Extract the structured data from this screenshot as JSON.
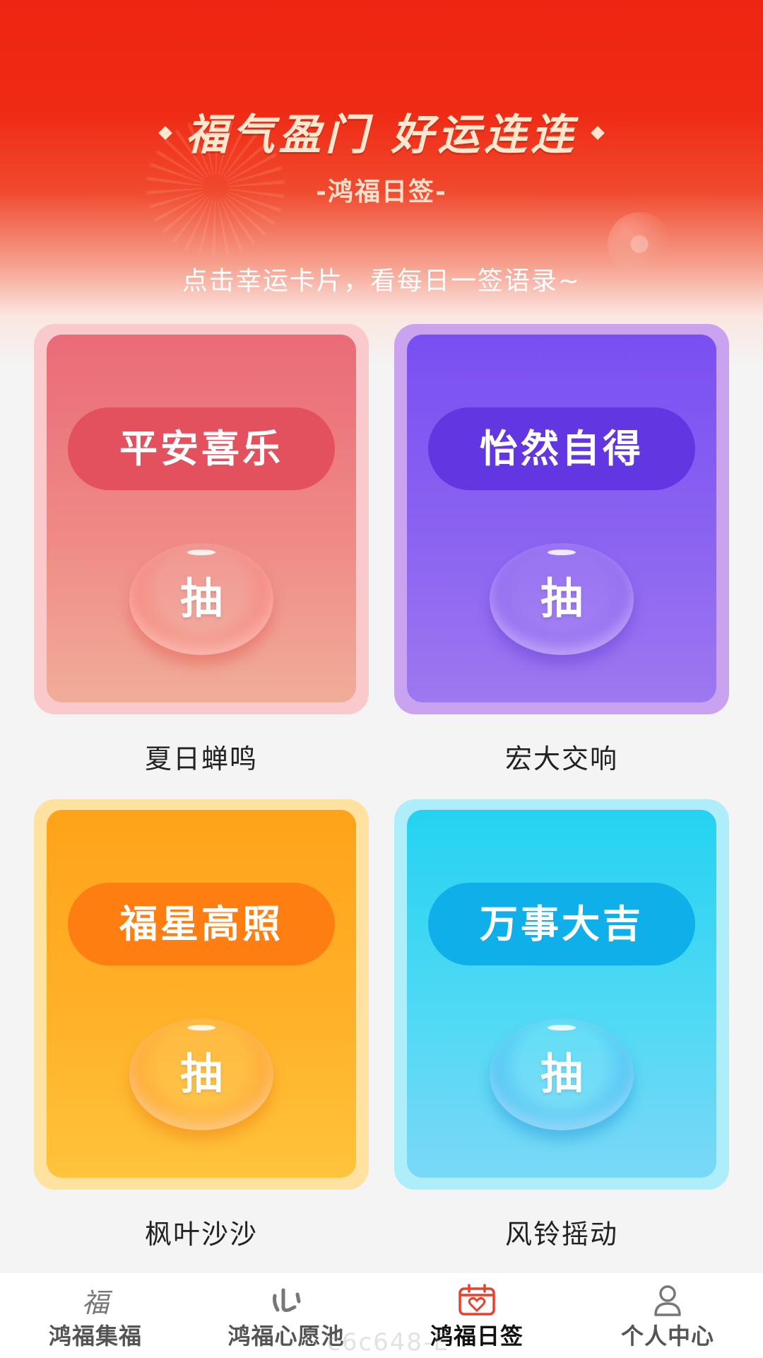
{
  "header": {
    "title": "福气盈门 好运连连",
    "subtitle": "-鸿福日签-",
    "tip": "点击幸运卡片，看每日一签语录~"
  },
  "cards": [
    {
      "pill": "平安喜乐",
      "button": "抽",
      "name": "夏日蝉鸣",
      "theme": "pink",
      "accent": "#e3505e"
    },
    {
      "pill": "怡然自得",
      "button": "抽",
      "name": "宏大交响",
      "theme": "purple",
      "accent": "#6236e0"
    },
    {
      "pill": "福星高照",
      "button": "抽",
      "name": "枫叶沙沙",
      "theme": "orange",
      "accent": "#ff7e11"
    },
    {
      "pill": "万事大吉",
      "button": "抽",
      "name": "风铃摇动",
      "theme": "cyan",
      "accent": "#0fb0ea"
    }
  ],
  "nav": {
    "items": [
      {
        "label": "鸿福集福",
        "icon": "fu-character-icon",
        "icon_text": "福",
        "active": false
      },
      {
        "label": "鸿福心愿池",
        "icon": "heart-wish-icon",
        "active": false
      },
      {
        "label": "鸿福日签",
        "icon": "calendar-heart-icon",
        "active": true
      },
      {
        "label": "个人中心",
        "icon": "user-icon",
        "active": false
      }
    ],
    "active_color": "#e8402c"
  },
  "watermark": "c6c648-E"
}
